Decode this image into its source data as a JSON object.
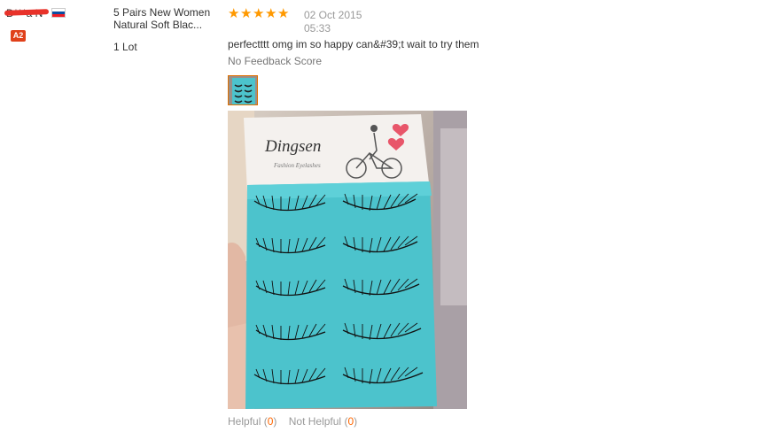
{
  "buyer": {
    "name": "D***a N",
    "level_badge": "A2",
    "flag_colors": [
      "#ffffff",
      "#0b4ea2",
      "#ee1c25"
    ]
  },
  "product": {
    "title": "5 Pairs New Women Natural Soft Blac...",
    "quantity": "1 Lot"
  },
  "review": {
    "rating": 5,
    "star_glyph": "★",
    "date": "02 Oct 2015",
    "time": "05:33",
    "text": "perfectttt omg im so happy can&#39;t wait to try them",
    "feedback_score": "No Feedback Score"
  },
  "photo": {
    "brand_text": "Dingsen",
    "subtitle_text": "Fashion Eyelashes"
  },
  "actions": {
    "helpful_label": "Helpful",
    "helpful_count": "0",
    "not_helpful_label": "Not Helpful",
    "not_helpful_count": "0"
  },
  "colors": {
    "star": "#ff9900",
    "count": "#ff6600",
    "badge": "#e0401a",
    "tray": "#4cc3cc"
  }
}
